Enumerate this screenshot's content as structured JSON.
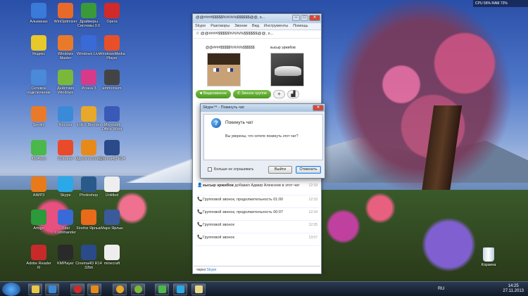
{
  "desktop_icons": [
    {
      "label": "Альманах",
      "color": "#3a7ad8"
    },
    {
      "label": "WinOptimizer",
      "color": "#e86a2a"
    },
    {
      "label": "Драйверы Системы 3.0",
      "color": "#3a9a3a"
    },
    {
      "label": "Opera",
      "color": "#d02a2a"
    },
    {
      "label": "Яндекс",
      "color": "#e8c82a"
    },
    {
      "label": "Windows Master",
      "color": "#e87a2a"
    },
    {
      "label": "Windows Live",
      "color": "#3a6ad8"
    },
    {
      "label": "WindowsMedia Player",
      "color": "#e8502a"
    },
    {
      "label": "Сетевое подключение",
      "color": "#4a8ad8"
    },
    {
      "label": "Действия Windows",
      "color": "#7ab83a"
    },
    {
      "label": "Picasa 3",
      "color": "#d83a8a"
    },
    {
      "label": "ammonium",
      "color": "#444444"
    },
    {
      "label": "Spotify",
      "color": "#e87a2a"
    },
    {
      "label": "Recuva",
      "color": "#3a8ad8"
    },
    {
      "label": "IcoFX Blender",
      "color": "#e8a82a"
    },
    {
      "label": "Microsoft Office Word",
      "color": "#3a5ab8"
    },
    {
      "label": "4504vpn",
      "color": "#4ab84a"
    },
    {
      "label": "Ccleaner",
      "color": "#e84a2a"
    },
    {
      "label": "Одноклассники",
      "color": "#e88a1a"
    },
    {
      "label": "Cinema4D R14",
      "color": "#2a4a8a"
    },
    {
      "label": "AIMP3",
      "color": "#e87a1a"
    },
    {
      "label": "Skype",
      "color": "#2aa8e8"
    },
    {
      "label": "Photoshop",
      "color": "#2a5a8a"
    },
    {
      "label": "Untitled",
      "color": "#eeeeee"
    },
    {
      "label": "Amigo",
      "color": "#2a9a3a"
    },
    {
      "label": "Total Commander",
      "color": "#3a6ad8"
    },
    {
      "label": "Firefox Ярлык",
      "color": "#e86a1a"
    },
    {
      "label": "Maps Ярлык",
      "color": "#3a5a9a"
    },
    {
      "label": "Adobe Reader XI",
      "color": "#c82a2a"
    },
    {
      "label": "KMPlayer",
      "color": "#2a2a2a"
    },
    {
      "label": "Cinema4D R14 32bit",
      "color": "#2a4a8a"
    },
    {
      "label": "minecraft",
      "color": "#eeeeee"
    }
  ],
  "topbar": {
    "text": "CPU 56%  RAM 72%"
  },
  "skype": {
    "title": "@@####$$$$$%%%%$$$$$$@@, s...",
    "window_buttons": {
      "min": "–",
      "max": "□",
      "close": "✕"
    },
    "menu": [
      "Skype",
      "Разговоры",
      "Звонки",
      "Вид",
      "Инструменты",
      "Помощь"
    ],
    "chat_header": "☆ @@####$$$$$%%%%$$$$$$@@, s...",
    "participants": [
      "@@####$$$$$%%%%$$$$$$",
      "кысыр эржибов"
    ],
    "video_call_label": "Видеозвонок",
    "group_call_label": "Звонок группе",
    "add_label": "+",
    "signal_label": "▟",
    "messages": [
      {
        "icon": "👤",
        "text_bold": "кысыр эржибов",
        "text": "добавил Адмир Алексеев в этот чат",
        "time": "12:33"
      },
      {
        "icon": "📞",
        "text_bold": "",
        "text": "Групповой звонок, продолжительность 01:00",
        "time": "12:33"
      },
      {
        "icon": "📞",
        "text_bold": "",
        "text": "Групповой звонок, продолжительность 00:07",
        "time": "12:34"
      },
      {
        "icon": "📞",
        "text_bold": "",
        "text": "Групповой звонок",
        "time": "12:35"
      },
      {
        "icon": "📞",
        "text_bold": "",
        "text": "Групповой звонок",
        "time": "13:07"
      }
    ],
    "input_prefix": "через",
    "input_link": "Skype"
  },
  "dialog": {
    "title": "Skype™ - Покинуть чат",
    "heading": "Покинуть чат",
    "text": "Вы уверены, что хотите покинуть этот чат?",
    "checkbox_label": "Больше не спрашивать",
    "exit_label": "Выйти",
    "cancel_label": "Отменить",
    "icon": "?"
  },
  "taskbar": {
    "lang": "RU",
    "time": "14:25",
    "date": "27.11.2013"
  },
  "recycle_bin": {
    "label": "Корзина"
  }
}
